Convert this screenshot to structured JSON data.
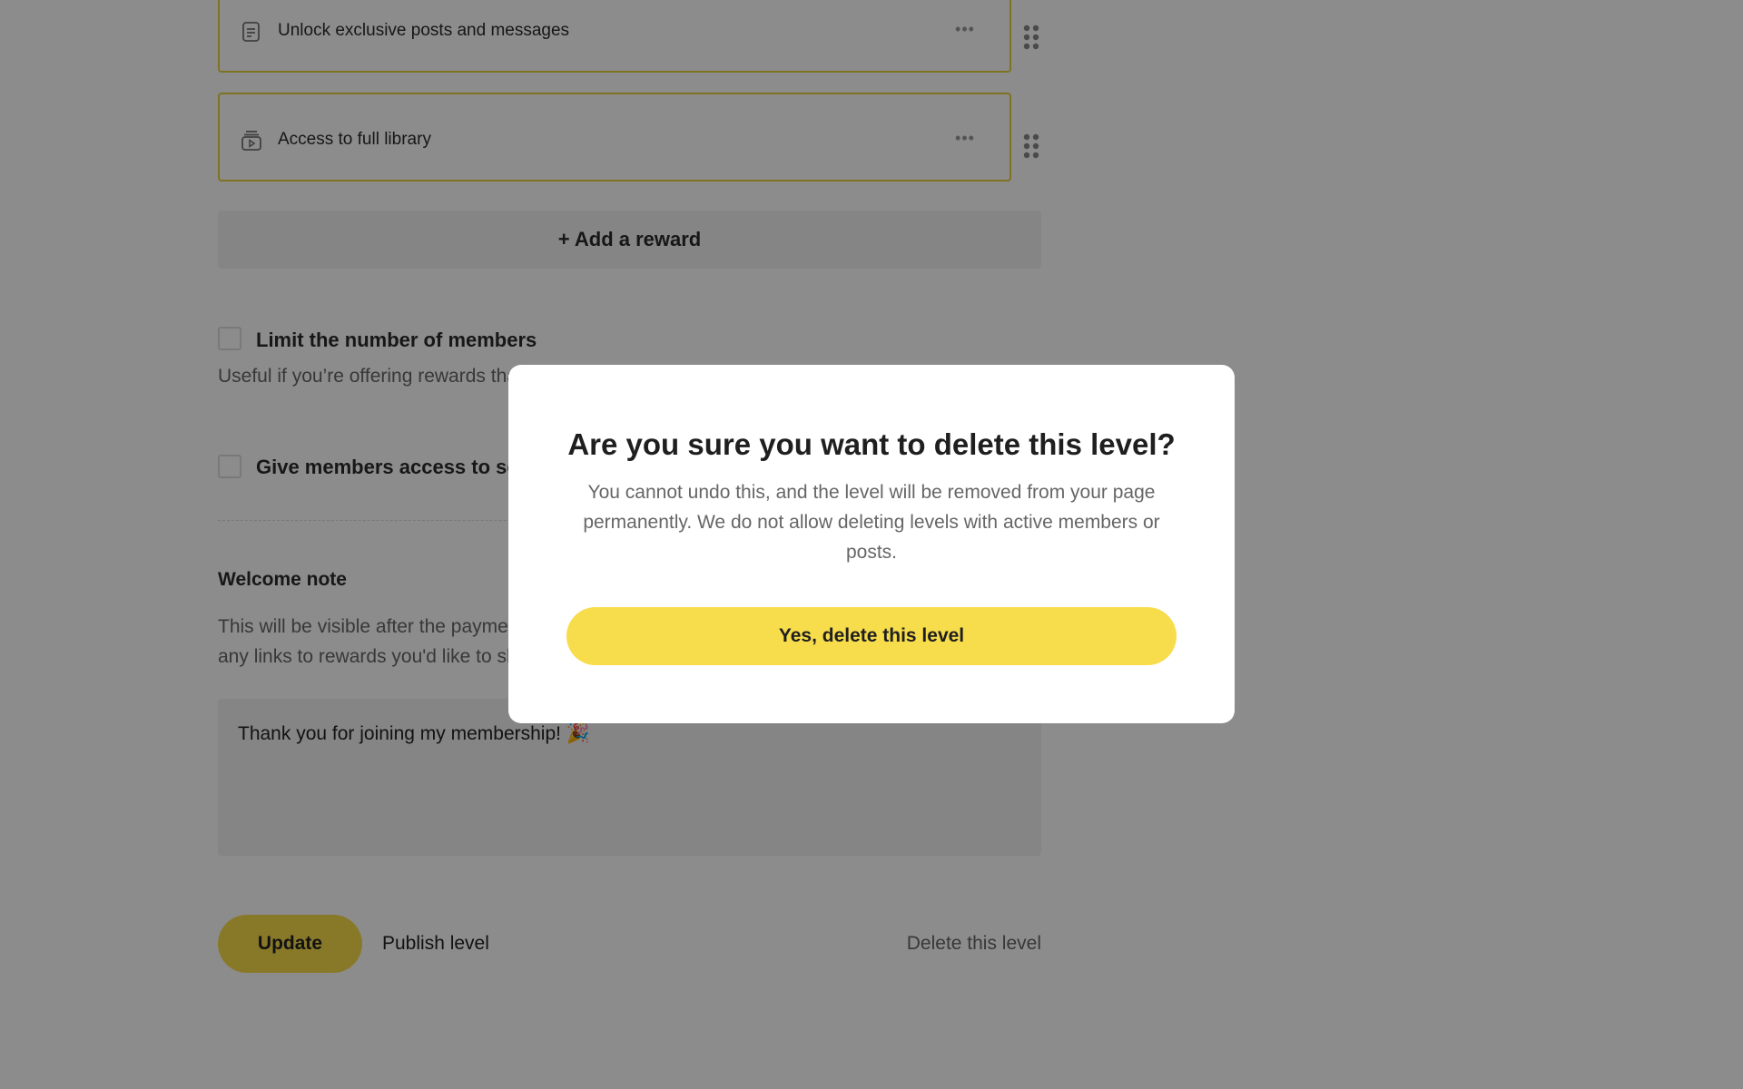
{
  "rewards": [
    {
      "icon": "document-icon",
      "label": "Unlock exclusive posts and messages",
      "more": "•••"
    },
    {
      "icon": "video-library-icon",
      "label": "Access to full library",
      "more": "•••"
    }
  ],
  "add_reward_label": "+ Add a reward",
  "options": {
    "limit_members": {
      "title": "Limit the number of members",
      "description": "Useful if you’re offering rewards that are limited in quantity, or to create a sense of urgency."
    },
    "select_access": {
      "title": "Give members access to select posts"
    }
  },
  "welcome": {
    "title": "Welcome note",
    "description": "This will be visible after the payment and in the welcome email. Make it personal, and include any links to rewards you'd like to share.",
    "value": "Thank you for joining my membership! 🎉"
  },
  "footer": {
    "update_label": "Update",
    "publish_label": "Publish level",
    "delete_label": "Delete this level"
  },
  "modal": {
    "title": "Are you sure you want to delete this level?",
    "body": "You cannot undo this, and the level will be removed from your page permanently. We do not allow deleting levels with active members or posts.",
    "confirm_label": "Yes, delete this level"
  },
  "colors": {
    "accent": "#f7dd4c",
    "reward_border": "#e6cf3f",
    "overlay": "rgba(0,0,0,0.45)"
  }
}
